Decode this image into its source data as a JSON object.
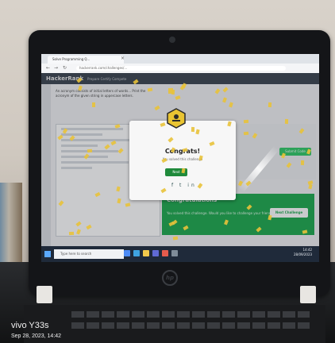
{
  "browser": {
    "tab_title": "Solve Programming Q...",
    "url": "hackerrank.com/challenges/..."
  },
  "site": {
    "logo": "HackerRank",
    "nav": "Prepare   Certify   Compete",
    "problem_text": "An acronym consists of initial letters of words... Print the acronym of the given string in uppercase letters.",
    "submit_label": "Submit Code"
  },
  "modal": {
    "title": "Congrats!",
    "subtitle": "You solved this challenge",
    "button_label": "Next"
  },
  "banner": {
    "title": "Congratulations",
    "subtitle": "You solved this challenge. Would you like to challenge your friends?",
    "button_label": "Next Challenge"
  },
  "taskbar": {
    "search_placeholder": "Type here to search",
    "time": "14:42",
    "date": "28/09/2023"
  },
  "laptop": {
    "brand": "hp"
  },
  "watermark": {
    "brand": "vivo Y33s",
    "date": "Sep 28, 2023, 14:42"
  },
  "colors": {
    "hr_green": "#1ba94c",
    "hr_header": "#39424e",
    "confetti": "#e8c23a"
  }
}
